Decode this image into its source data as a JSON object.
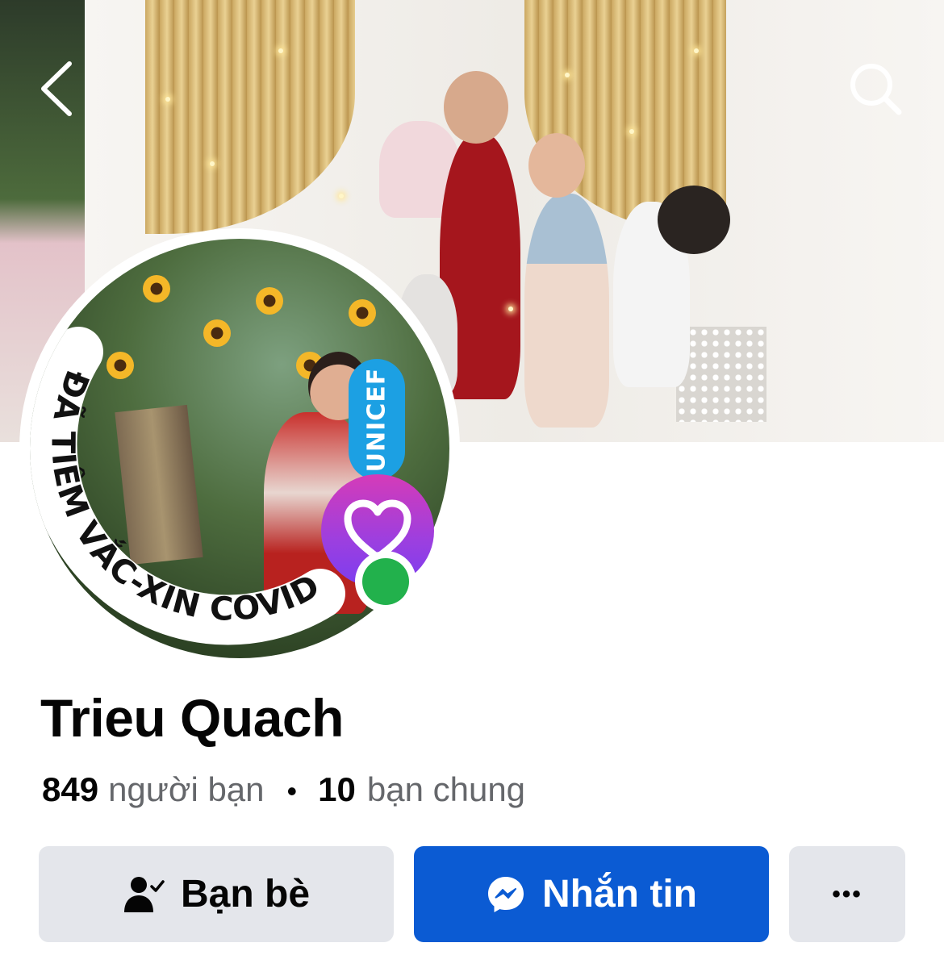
{
  "header": {
    "back_icon": "chevron-left-icon",
    "search_icon": "search-icon"
  },
  "avatar": {
    "frame_text": "ĐÃ TIÊM VẮC-XIN COVID-19",
    "badge_text": "UNICEF",
    "heart_icon": "heart-icon",
    "online_status_color": "#22b14c"
  },
  "profile": {
    "name": "Trieu Quach",
    "friends_count": "849",
    "friends_label": "người bạn",
    "separator": "•",
    "mutual_count": "10",
    "mutual_label": "bạn chung"
  },
  "actions": {
    "friends_label": "Bạn bè",
    "friends_icon": "person-check-icon",
    "message_label": "Nhắn tin",
    "message_icon": "messenger-icon",
    "more_label": "•••"
  },
  "colors": {
    "primary_button": "#0b5bd3",
    "secondary_button": "#e4e6eb"
  }
}
